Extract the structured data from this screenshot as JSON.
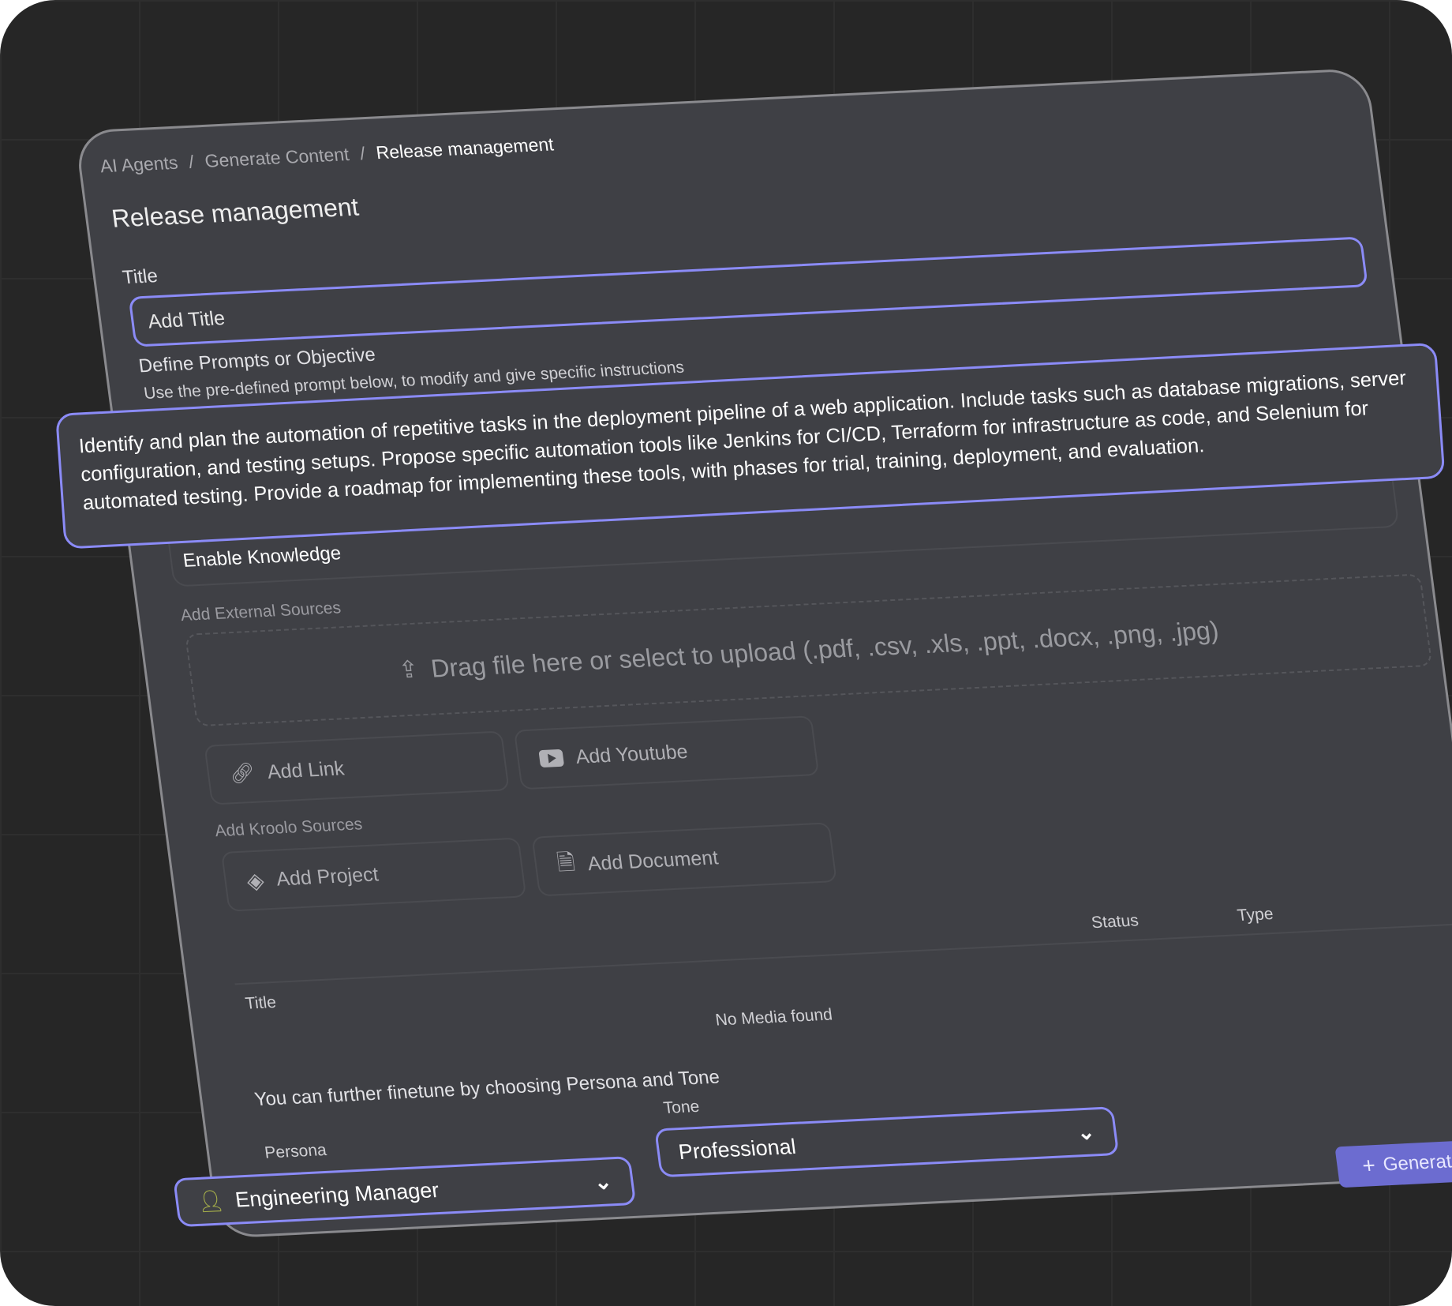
{
  "breadcrumb": [
    "AI Agents",
    "Generate Content",
    "Release management"
  ],
  "page_title": "Release management",
  "title_field": {
    "label": "Title",
    "placeholder": "Add Title"
  },
  "prompt": {
    "label": "Define Prompts or Objective",
    "hint": "Use the pre-defined prompt below, to modify and give specific instructions",
    "value": "Identify and plan the automation of repetitive tasks in the deployment pipeline of a web application. Include tasks such as database migrations, server configuration, and testing setups. Propose specific automation tools like Jenkins for CI/CD, Terraform for infrastructure as code, and Selenium for automated testing. Provide a roadmap for implementing these tools, with phases for trial, training, deployment, and evaluation."
  },
  "knowledge": {
    "label": "Enable Knowledge",
    "enabled": false
  },
  "external": {
    "label": "Add External Sources",
    "drop_text": "Drag file here or select to upload (.pdf, .csv, .xls, .ppt, .docx, .png, .jpg)",
    "add_link": "Add Link",
    "add_youtube": "Add Youtube"
  },
  "kroolo": {
    "label": "Add Kroolo Sources",
    "add_project": "Add Project",
    "add_document": "Add Document"
  },
  "table": {
    "columns": [
      "Title",
      "Status",
      "Type"
    ],
    "empty": "No Media found"
  },
  "finetune": {
    "text": "You can further finetune by choosing Persona and Tone",
    "persona_label": "Persona",
    "persona_value": "Engineering Manager",
    "tone_label": "Tone",
    "tone_value": "Professional"
  },
  "generate_label": "Generate",
  "colors": {
    "accent": "#8b8bf7",
    "button": "#6c6cd0",
    "card": "#3f4045",
    "background": "#262626"
  }
}
